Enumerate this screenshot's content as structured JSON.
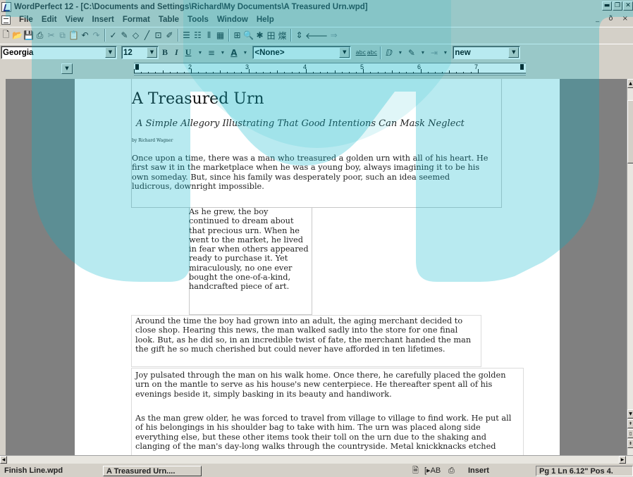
{
  "window": {
    "title": "WordPerfect 12 - [C:\\Documents and Settings\\Richard\\My Documents\\A Treasured Urn.wpd]",
    "controls": [
      "minimize",
      "restore",
      "close"
    ]
  },
  "menu": {
    "items": [
      "File",
      "Edit",
      "View",
      "Insert",
      "Format",
      "Table",
      "Tools",
      "Window",
      "Help"
    ],
    "right_controls": "_ ð ×"
  },
  "toolbar": {
    "font_name": "Georgia",
    "font_size": "12",
    "bold": "B",
    "italic": "I",
    "underline": "U",
    "style": "<None>",
    "abc1": "abc",
    "abc2": "abc",
    "zoom": "new"
  },
  "ruler": {
    "marks": [
      "2",
      "3",
      "4",
      "5",
      "6",
      "7"
    ]
  },
  "document": {
    "title": "A Treasured Urn",
    "subtitle": "A Simple Allegory Illustrating That Good Intentions Can Mask Neglect",
    "byline": "by Richard Wagner",
    "para1": [
      "Once upon a time, there was a man who treasured a golden urn with all of his heart. He",
      "first saw it in the marketplace when he was a young boy, always imagining it to be his",
      "own someday. But, since his family was desperately poor, such an idea seemed",
      "ludicrous, downright impossible."
    ],
    "para2": [
      "As he grew, the boy",
      "continued to dream about",
      "that precious urn. When he",
      "went to the market, he lived",
      "in fear when others appeared",
      "ready to purchase it. Yet",
      "miraculously, no one ever",
      "bought the one-of-a-kind,",
      "handcrafted piece of art."
    ],
    "para3": [
      "Around the time the boy had grown into an adult, the aging merchant decided to",
      "close shop. Hearing this news, the man walked sadly into the store for one final",
      "look. But, as he did so, in an incredible twist of fate, the merchant handed the man",
      "the gift he so much cherished but could never have afforded in ten lifetimes."
    ],
    "para4": [
      "Joy pulsated through the man on his walk home. Once there, he carefully placed the golden",
      "urn on the mantle to serve as his house's new centerpiece. He thereafter spent all of his",
      "evenings beside it, simply basking in its beauty and handiwork."
    ],
    "para5": [
      "As the man grew older, he was forced to travel from village to village to find work. He put all",
      "of his belongings in his shoulder bag to take with him. The urn was placed along side",
      "everything else, but these other items took their toll on the urn due to the shaking and",
      "clanging of the man's day-long walks through the countryside. Metal knickknacks etched"
    ]
  },
  "status": {
    "tab1": "Finish Line.wpd",
    "tab2": "A Treasured Urn....",
    "mode_icons": "[▸AB",
    "insert": "Insert",
    "position": "Pg 1 Ln 6.12\" Pos 4."
  },
  "colors": {
    "chrome": "#d4d0c8",
    "workspace": "#808080",
    "watermark": "#00b4c8"
  }
}
